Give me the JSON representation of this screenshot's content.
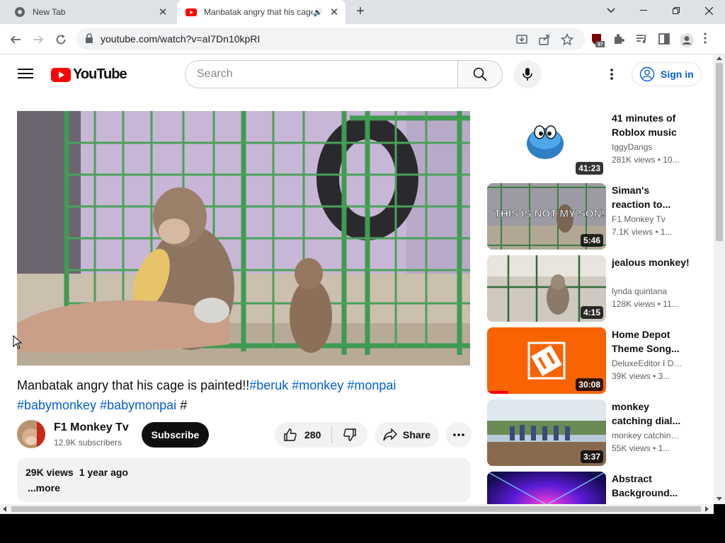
{
  "browser": {
    "tabs": [
      {
        "title": "New Tab"
      },
      {
        "title": "Manbatak angry that his cage"
      }
    ],
    "url": "youtube.com/watch?v=aI7Dn10kpRI",
    "extension_badge": "87"
  },
  "masthead": {
    "logo_text": "YouTube",
    "search_placeholder": "Search",
    "signin_label": "Sign in"
  },
  "video": {
    "title_plain": "Manbatak angry that his cage is painted!!",
    "hashtags": [
      "#beruk",
      "#monkey",
      "#monpai",
      "#babymonkey",
      "#babymonpai",
      "#"
    ],
    "channel": "F1 Monkey Tv",
    "subscribers": "12.9K subscribers",
    "subscribe_label": "Subscribe",
    "likes": "280",
    "share_label": "Share",
    "views": "29K views",
    "age": "1 year ago",
    "more_label": "...more"
  },
  "recommendations": [
    {
      "title": "41 minutes of Roblox music",
      "channel": "IggyDangs",
      "meta": "281K views • 10...",
      "duration": "41:23"
    },
    {
      "title": "Siman's reaction to...",
      "channel": "F1 Monkey Tv",
      "meta": "7.1K views • 1...",
      "duration": "5:46",
      "thumb_text": "THIS IS NOT MY SON!"
    },
    {
      "title": "jealous monkey!",
      "channel": "lynda quintana",
      "meta": "128K views • 11...",
      "duration": "4:15"
    },
    {
      "title": "Home Depot Theme Song...",
      "channel": "DeluxeEditor I DJ...",
      "meta": "39K views • 3...",
      "duration": "30:08"
    },
    {
      "title": "monkey catching dial...",
      "channel": "monkey catching...",
      "meta": "55K views • 1...",
      "duration": "3:37"
    },
    {
      "title": "Abstract Background...",
      "channel": "",
      "meta": "",
      "duration": ""
    }
  ],
  "colors": {
    "brand_red": "#ff0000",
    "link_blue": "#065fd4",
    "cage_green": "#3f9a52",
    "home_depot_orange": "#f96302"
  }
}
